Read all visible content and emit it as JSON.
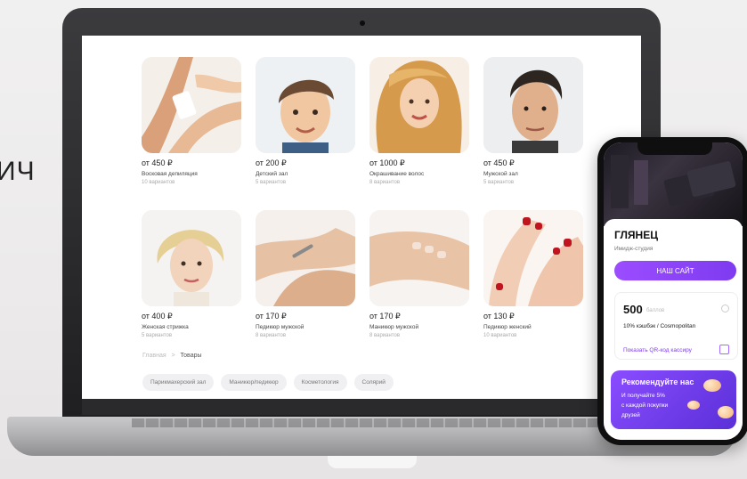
{
  "side_text": "ИЧ",
  "products": [
    {
      "price": "от 450 ₽",
      "name": "Восковая депиляция",
      "variants": "10 вариантов",
      "img": "waxing-photo"
    },
    {
      "price": "от 200 ₽",
      "name": "Детский зал",
      "variants": "5 вариантов",
      "img": "boy-haircut-photo"
    },
    {
      "price": "от 1000 ₽",
      "name": "Окрашивание волос",
      "variants": "8 вариантов",
      "img": "hair-coloring-photo"
    },
    {
      "price": "от 450 ₽",
      "name": "Мужской зал",
      "variants": "5 вариантов",
      "img": "mens-haircut-photo"
    },
    {
      "price": "от 400 ₽",
      "name": "Женская стрижка",
      "variants": "5 вариантов",
      "img": "womens-haircut-photo"
    },
    {
      "price": "от 170 ₽",
      "name": "Педикюр мужской",
      "variants": "8 вариантов",
      "img": "mens-pedicure-photo"
    },
    {
      "price": "от 170 ₽",
      "name": "Маникюр мужской",
      "variants": "8 вариантов",
      "img": "mens-manicure-photo"
    },
    {
      "price": "от 130 ₽",
      "name": "Педикюр женский",
      "variants": "10 вариантов",
      "img": "womens-pedicure-photo"
    }
  ],
  "breadcrumb": {
    "home": "Главная",
    "sep": ">",
    "current": "Товары"
  },
  "chips": [
    "Парикмахерский зал",
    "Маникюр/педикюр",
    "Косметология",
    "Солярий"
  ],
  "phone": {
    "brand": "ГЛЯНЕЦ",
    "subtitle": "Имидж-студия",
    "site_button": "НАШ САЙТ",
    "points": "500",
    "points_label": "баллов",
    "cashback": "10% кэшбэк / Cosmopolitan",
    "qr_link": "Показать QR-код кассиру",
    "refer_title": "Рекомендуйте нас",
    "refer_lines": [
      "И получайте 5%",
      "с каждой покупки",
      "друзей"
    ]
  },
  "colors": {
    "accent": "#8a4dff",
    "text": "#222222",
    "muted": "#aaaaaa"
  }
}
